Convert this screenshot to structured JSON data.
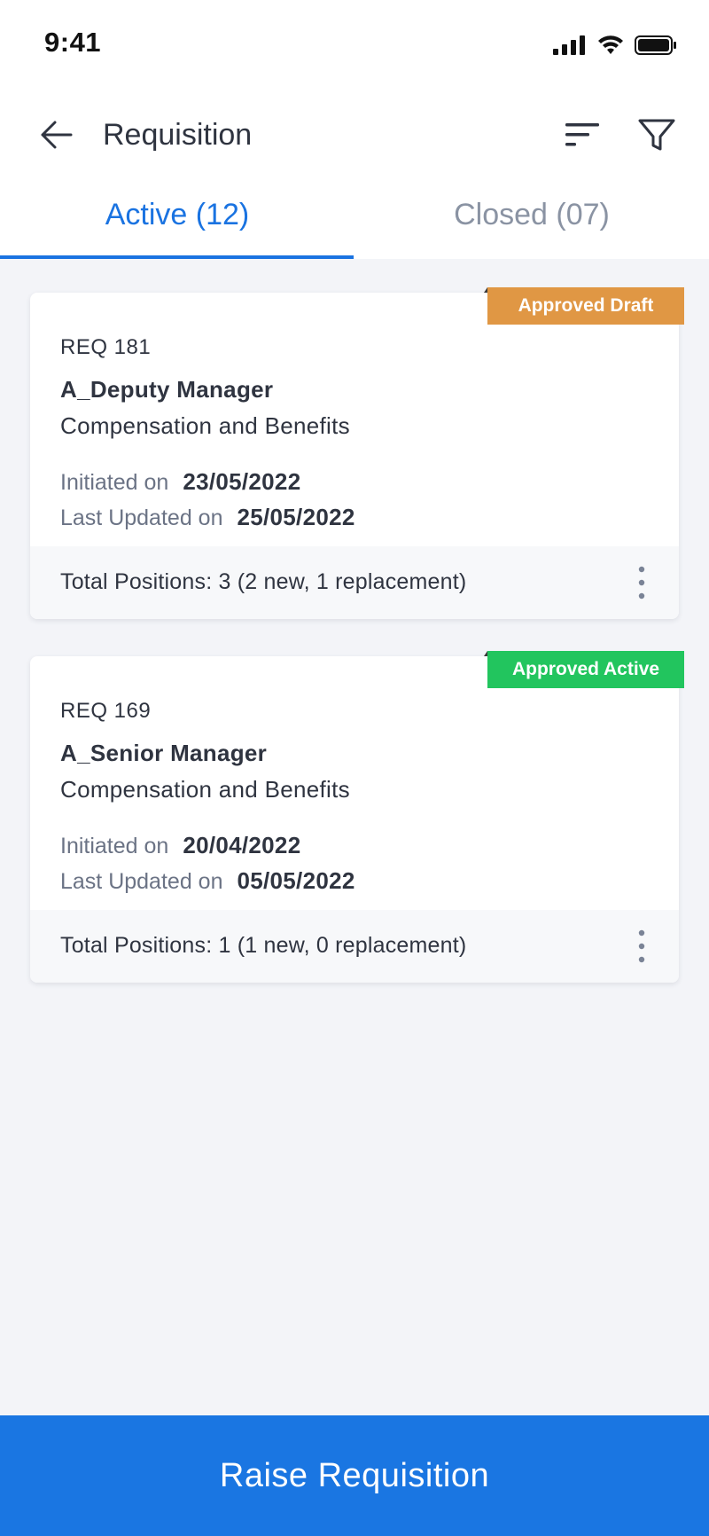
{
  "status_bar": {
    "time": "9:41"
  },
  "header": {
    "title": "Requisition",
    "back_icon": "arrow-left-icon",
    "sort_icon": "sort-lines-icon",
    "filter_icon": "filter-funnel-icon"
  },
  "tabs": [
    {
      "label": "Active (12)",
      "active": true
    },
    {
      "label": "Closed (07)",
      "active": false
    }
  ],
  "colors": {
    "primary": "#1a73e1",
    "draft_badge": "#e09744",
    "active_badge": "#22c55e",
    "background": "#f3f4f8"
  },
  "requisitions": [
    {
      "badge": "Approved Draft",
      "req_id": "REQ 181",
      "role": "A_Deputy Manager",
      "department": "Compensation and Benefits",
      "initiated_label": "Initiated on",
      "initiated_value": "23/05/2022",
      "updated_label": "Last Updated on",
      "updated_value": "25/05/2022",
      "positions": "Total Positions: 3 (2 new, 1 replacement)"
    },
    {
      "badge": "Approved Active",
      "req_id": "REQ 169",
      "role": "A_Senior Manager",
      "department": "Compensation and Benefits",
      "initiated_label": "Initiated on",
      "initiated_value": "20/04/2022",
      "updated_label": "Last Updated on",
      "updated_value": "05/05/2022",
      "positions": "Total Positions: 1 (1 new, 0 replacement)"
    }
  ],
  "cta": {
    "label": "Raise Requisition"
  }
}
